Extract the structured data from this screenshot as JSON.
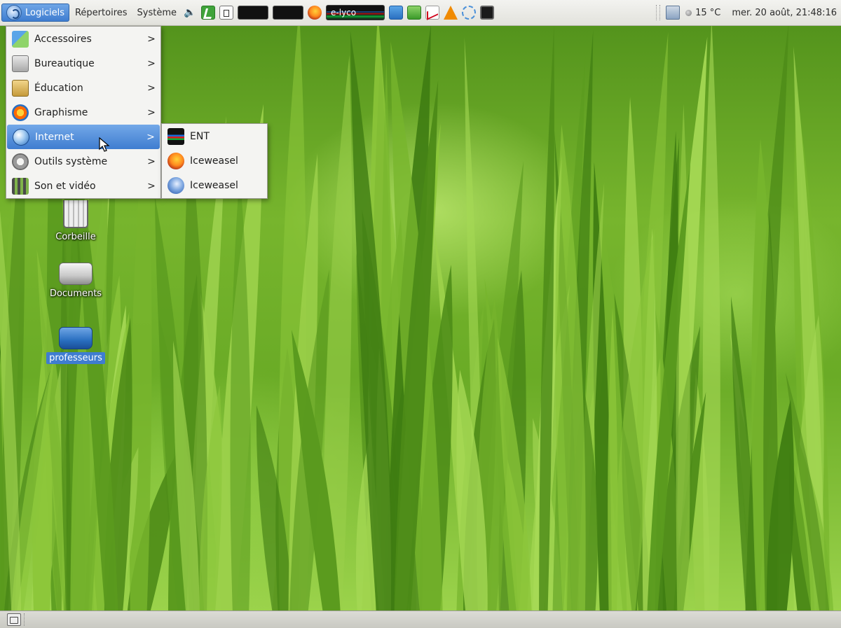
{
  "top_panel": {
    "menus": [
      {
        "label": "Logiciels",
        "active": true
      },
      {
        "label": "Répertoires",
        "active": false
      },
      {
        "label": "Système",
        "active": false
      }
    ],
    "launchers": [
      "speaker-icon",
      "exit-icon",
      "window-icon",
      "terminal-black-icon",
      "terminal-black-icon",
      "firefox-icon",
      "e-lyco-launcher",
      "document-blue-icon",
      "spreadsheet-green-icon",
      "chart-icon",
      "vlc-icon",
      "shape-icon",
      "screen-icon"
    ],
    "elyco_label": "e-lyco",
    "weather": "15 °C",
    "clock": "mer. 20 août, 21:48:16"
  },
  "desktop_icons": [
    {
      "label": "Corbeille",
      "icon": "trash-icon"
    },
    {
      "label": "Documents",
      "icon": "drive-icon"
    },
    {
      "label": "professeurs",
      "icon": "network-drive-icon",
      "selected": true
    }
  ],
  "applications_menu": {
    "items": [
      {
        "label": "Accessoires",
        "icon": "accessories-icon",
        "submenu": true
      },
      {
        "label": "Bureautique",
        "icon": "office-icon",
        "submenu": true
      },
      {
        "label": "Éducation",
        "icon": "education-icon",
        "submenu": true
      },
      {
        "label": "Graphisme",
        "icon": "graphics-icon",
        "submenu": true
      },
      {
        "label": "Internet",
        "icon": "internet-icon",
        "submenu": true,
        "highlighted": true
      },
      {
        "label": "Outils système",
        "icon": "system-tools-icon",
        "submenu": true
      },
      {
        "label": "Son et vidéo",
        "icon": "sound-video-icon",
        "submenu": true
      }
    ],
    "arrow": ">"
  },
  "internet_submenu": {
    "items": [
      {
        "label": "ENT",
        "icon": "ent-icon"
      },
      {
        "label": "Iceweasel",
        "icon": "firefox-icon"
      },
      {
        "label": "Iceweasel",
        "icon": "iceweasel-icon"
      }
    ]
  },
  "colors": {
    "highlight": "#3f7dd0",
    "panel": "#e8e8e3",
    "grass": "#77b52d"
  }
}
